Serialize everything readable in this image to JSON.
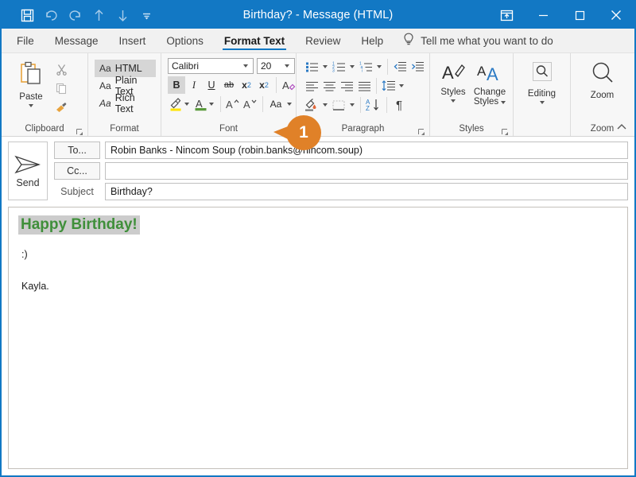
{
  "window": {
    "title": "Birthday? - Message (HTML)",
    "accent_color": "#1278c4",
    "quick_access": [
      {
        "name": "save-icon",
        "label": "Save"
      },
      {
        "name": "undo-icon",
        "label": "Undo"
      },
      {
        "name": "redo-icon",
        "label": "Redo"
      },
      {
        "name": "previous-item-icon",
        "label": "Previous Item"
      },
      {
        "name": "next-item-icon",
        "label": "Next Item"
      },
      {
        "name": "customize-quick-access-toolbar-icon",
        "label": "Customize Quick Access Toolbar"
      }
    ],
    "controls": [
      {
        "name": "ribbon-display-options",
        "label": "Ribbon Display Options"
      },
      {
        "name": "minimize",
        "label": "Minimize"
      },
      {
        "name": "maximize",
        "label": "Maximize"
      },
      {
        "name": "close",
        "label": "Close"
      }
    ]
  },
  "tabs": [
    {
      "label": "File",
      "active": false
    },
    {
      "label": "Message",
      "active": false
    },
    {
      "label": "Insert",
      "active": false
    },
    {
      "label": "Options",
      "active": false
    },
    {
      "label": "Format Text",
      "active": true
    },
    {
      "label": "Review",
      "active": false
    },
    {
      "label": "Help",
      "active": false
    }
  ],
  "tell_me": {
    "icon": "lightbulb-icon",
    "placeholder": "Tell me what you want to do"
  },
  "ribbon": {
    "groups": [
      {
        "label": "Clipboard",
        "has_launcher": true
      },
      {
        "label": "Format",
        "has_launcher": false
      },
      {
        "label": "Font",
        "has_launcher": true
      },
      {
        "label": "Paragraph",
        "has_launcher": true
      },
      {
        "label": "Styles",
        "has_launcher": true
      },
      {
        "label": "Zoom",
        "has_launcher": false
      }
    ],
    "clipboard": {
      "paste_label": "Paste",
      "cut_label": "Cut",
      "copy_label": "Copy",
      "format_painter_label": "Format Painter"
    },
    "format": {
      "items": [
        {
          "aa": "Aa",
          "label": "HTML",
          "selected": true
        },
        {
          "aa": "Aa",
          "label": "Plain Text",
          "selected": false
        },
        {
          "aa": "Aa",
          "label": "Rich Text",
          "selected": false
        }
      ]
    },
    "font": {
      "font_name": "Calibri",
      "font_size": "20",
      "bold_label": "B",
      "bold_active": true,
      "italic_label": "I",
      "underline_label": "U",
      "strikethrough_label": "ab",
      "subscript_label": "x",
      "subscript_sub": "2",
      "superscript_label": "x",
      "superscript_sup": "2",
      "clear_formatting_label": "Clear All Formatting",
      "text_highlight_label": "Text Highlight Color",
      "font_color_label": "Font Color",
      "grow_font_label": "A",
      "shrink_font_label": "A",
      "change_case_label": "Aa"
    },
    "paragraph": {
      "bullets_label": "Bullets",
      "numbering_label": "Numbering",
      "multilevel_label": "Multilevel List",
      "decrease_indent_label": "Decrease Indent",
      "increase_indent_label": "Increase Indent",
      "align_left_label": "Align Left",
      "center_label": "Center",
      "align_right_label": "Align Right",
      "justify_label": "Justify",
      "line_spacing_label": "Line and Paragraph Spacing",
      "shading_label": "Shading",
      "borders_label": "Borders",
      "sort_label": "Sort",
      "show_marks_label": "Show/Hide Formatting Marks"
    },
    "styles": {
      "styles_label": "Styles",
      "change_styles_line1": "Change",
      "change_styles_line2": "Styles"
    },
    "editing": {
      "label": "Editing"
    },
    "zoom": {
      "label": "Zoom"
    },
    "collapse_label": "Collapse the Ribbon"
  },
  "compose": {
    "send_label": "Send",
    "to_button": "To...",
    "to_value": "Robin Banks - Nincom Soup (robin.banks@nincom.soup)",
    "cc_button": "Cc...",
    "cc_value": "",
    "subject_label": "Subject",
    "subject_value": "Birthday?",
    "body": {
      "greeting": "Happy Birthday!",
      "greeting_color": "#3f8f3a",
      "greeting_highlight": "#cccccc",
      "line2": ":)",
      "line3": "Kayla."
    }
  },
  "callout": {
    "number": "1",
    "color": "#e08128"
  }
}
